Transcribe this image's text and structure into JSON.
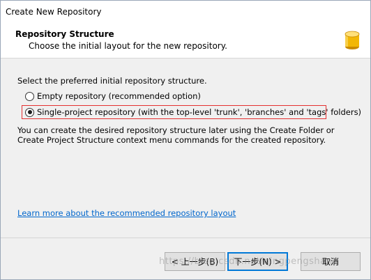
{
  "window": {
    "title": "Create New Repository"
  },
  "header": {
    "title": "Repository Structure",
    "subtitle": "Choose the initial layout for the new repository.",
    "icon": "database-icon"
  },
  "content": {
    "prompt": "Select the preferred initial repository structure.",
    "options": [
      {
        "label": "Empty repository (recommended option)",
        "selected": false
      },
      {
        "label": "Single-project repository (with the top-level 'trunk', 'branches' and 'tags' folders)",
        "selected": true
      }
    ],
    "description": "You can create the desired repository structure later using the Create Folder or Create Project Structure context menu commands for the created repository.",
    "learn_more_link": "Learn more about the recommended repository layout"
  },
  "footer": {
    "back_label": "< 上一步(B)",
    "next_label": "下一步(N) >",
    "cancel_label": "取消"
  },
  "watermark": "https://blog.csdn.net/qingpengshan",
  "colors": {
    "highlight": "#e53030",
    "link": "#0066cc",
    "accent": "#0078d7"
  }
}
